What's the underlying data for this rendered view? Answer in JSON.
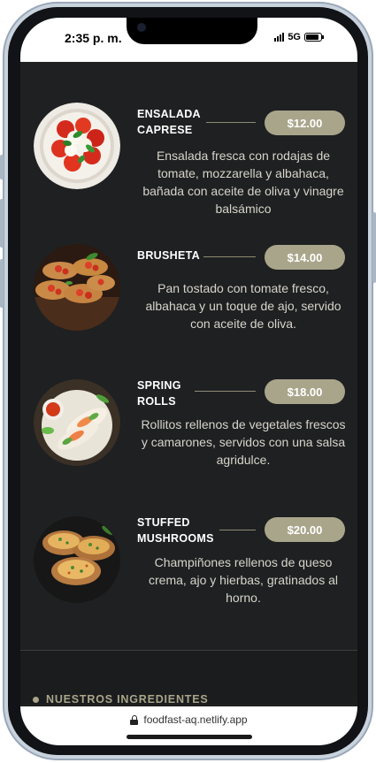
{
  "status_bar": {
    "time": "2:35 p. m.",
    "network": "5G",
    "battery_level": 0.9
  },
  "menu": {
    "items": [
      {
        "name_line1": "ENSALADA",
        "name_line2": "CAPRESE",
        "price": "$12.00",
        "description": "Ensalada fresca con rodajas de tomate, mozzarella y albahaca, bañada con aceite de oliva y vinagre balsámico",
        "image_icon": "caprese-salad-image"
      },
      {
        "name_line1": "BRUSHETA",
        "name_line2": "",
        "price": "$14.00",
        "description": "Pan tostado con tomate fresco, albahaca y un toque de ajo, servido con aceite de oliva.",
        "image_icon": "bruschetta-image"
      },
      {
        "name_line1": "SPRING",
        "name_line2": "ROLLS",
        "price": "$18.00",
        "description": "Rollitos rellenos de vegetales frescos y camarones, servidos con una salsa agridulce.",
        "image_icon": "spring-rolls-image"
      },
      {
        "name_line1": "STUFFED",
        "name_line2": "MUSHROOMS",
        "price": "$20.00",
        "description": "Champiñones rellenos de queso crema, ajo y hierbas, gratinados al horno.",
        "image_icon": "stuffed-mushrooms-image"
      }
    ]
  },
  "ingredients": {
    "title": "NUESTROS INGREDIENTES"
  },
  "browser": {
    "url": "foodfast-aq.netlify.app"
  },
  "colors": {
    "accent": "#a9a58b",
    "background": "#1f2021",
    "text_light": "#d6d4cc"
  }
}
